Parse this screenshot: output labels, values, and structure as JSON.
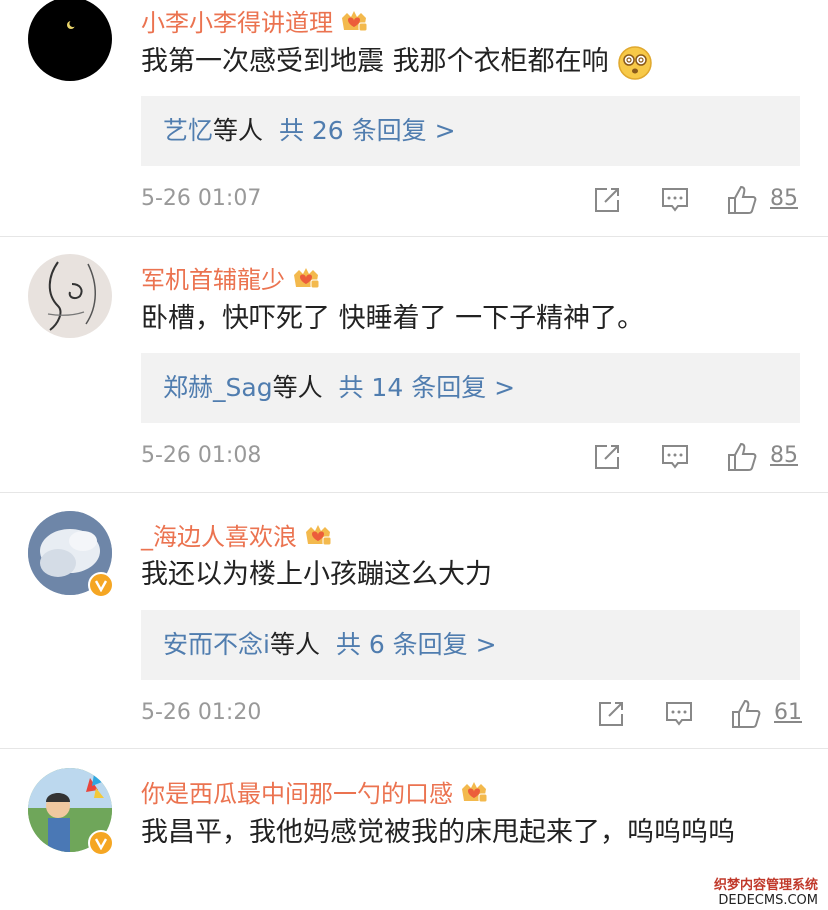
{
  "colors": {
    "username": "#eb7350",
    "link": "#507daf",
    "text": "#222222",
    "meta": "#999999",
    "reply_bg": "#f2f2f2"
  },
  "comments": [
    {
      "username": "小李小李得讲道理",
      "text": "我第一次感受到地震 我那个衣柜都在响",
      "reply_name": "艺忆",
      "reply_mid": "等人",
      "reply_count": "共 26 条回复 >",
      "time": "5-26 01:07",
      "likes": "85",
      "emoji": "dizzy-face-icon"
    },
    {
      "username": "军机首辅龍少",
      "text": "卧槽，快吓死了 快睡着了 一下子精神了。",
      "reply_name": "郑赫_Sag",
      "reply_mid": "等人",
      "reply_count": "共 14 条回复 >",
      "time": "5-26 01:08",
      "likes": "85"
    },
    {
      "username": "_海边人喜欢浪",
      "text": "我还以为楼上小孩蹦这么大力",
      "reply_name": "安而不念i",
      "reply_mid": "等人",
      "reply_count": "共 6 条回复 >",
      "time": "5-26 01:20",
      "likes": "61"
    },
    {
      "username": "你是西瓜最中间那一勺的口感",
      "text": "我昌平，我他妈感觉被我的床甩起来了，呜呜呜呜"
    }
  ],
  "watermark": {
    "line1": "织梦内容管理系统",
    "line2": "DEDECMS.COM"
  }
}
